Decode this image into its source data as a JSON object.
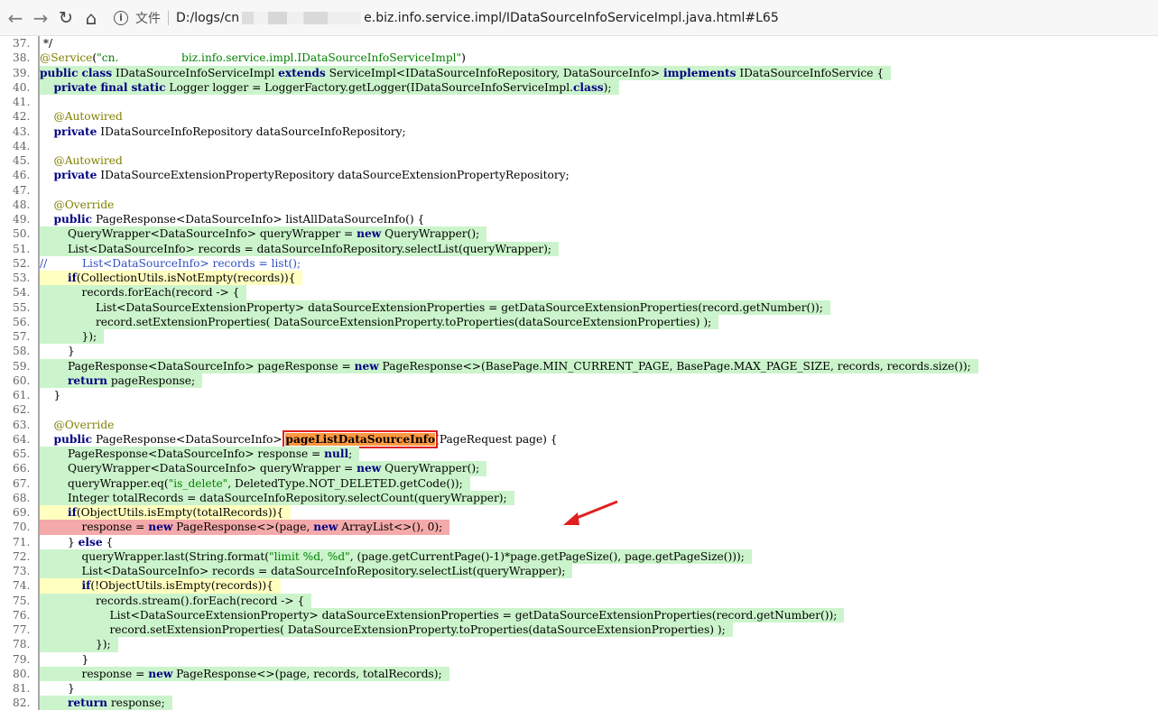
{
  "browser": {
    "back_icon": "back-arrow-icon",
    "forward_icon": "forward-arrow-icon",
    "reload_icon": "reload-icon",
    "home_icon": "home-icon",
    "file_label": "文件",
    "url_prefix": "D:/logs/cn",
    "url_rest": "e.biz.info.service.impl/IDataSourceInfoServiceImpl.java.html#L65"
  },
  "code_lines": [
    {
      "num": "37.",
      "text": " */",
      "hl": ""
    },
    {
      "num": "38.",
      "text": "@Service(\"cn.                  biz.info.service.impl.IDataSourceInfoServiceImpl\")",
      "hl": ""
    },
    {
      "num": "39.",
      "text": "public class IDataSourceInfoServiceImpl extends ServiceImpl<IDataSourceInfoRepository, DataSourceInfo> implements IDataSourceInfoService {",
      "hl": "green"
    },
    {
      "num": "40.",
      "text": "    private final static Logger logger = LoggerFactory.getLogger(IDataSourceInfoServiceImpl.class);",
      "hl": "green"
    },
    {
      "num": "41.",
      "text": "",
      "hl": ""
    },
    {
      "num": "42.",
      "text": "    @Autowired",
      "hl": ""
    },
    {
      "num": "43.",
      "text": "    private IDataSourceInfoRepository dataSourceInfoRepository;",
      "hl": ""
    },
    {
      "num": "44.",
      "text": "",
      "hl": ""
    },
    {
      "num": "45.",
      "text": "    @Autowired",
      "hl": ""
    },
    {
      "num": "46.",
      "text": "    private IDataSourceExtensionPropertyRepository dataSourceExtensionPropertyRepository;",
      "hl": ""
    },
    {
      "num": "47.",
      "text": "",
      "hl": ""
    },
    {
      "num": "48.",
      "text": "    @Override",
      "hl": ""
    },
    {
      "num": "49.",
      "text": "    public PageResponse<DataSourceInfo> listAllDataSourceInfo() {",
      "hl": ""
    },
    {
      "num": "50.",
      "text": "        QueryWrapper<DataSourceInfo> queryWrapper = new QueryWrapper();",
      "hl": "green"
    },
    {
      "num": "51.",
      "text": "        List<DataSourceInfo> records = dataSourceInfoRepository.selectList(queryWrapper);",
      "hl": "green"
    },
    {
      "num": "52.",
      "text": "//          List<DataSourceInfo> records = list();",
      "hl": "comment"
    },
    {
      "num": "53.",
      "text": "        if(CollectionUtils.isNotEmpty(records)){",
      "hl": "yellow"
    },
    {
      "num": "54.",
      "text": "            records.forEach(record -> {",
      "hl": "green"
    },
    {
      "num": "55.",
      "text": "                List<DataSourceExtensionProperty> dataSourceExtensionProperties = getDataSourceExtensionProperties(record.getNumber());",
      "hl": "green"
    },
    {
      "num": "56.",
      "text": "                record.setExtensionProperties( DataSourceExtensionProperty.toProperties(dataSourceExtensionProperties) );",
      "hl": "green"
    },
    {
      "num": "57.",
      "text": "            });",
      "hl": "green"
    },
    {
      "num": "58.",
      "text": "        }",
      "hl": ""
    },
    {
      "num": "59.",
      "text": "        PageResponse<DataSourceInfo> pageResponse = new PageResponse<>(BasePage.MIN_CURRENT_PAGE, BasePage.MAX_PAGE_SIZE, records, records.size());",
      "hl": "green"
    },
    {
      "num": "60.",
      "text": "        return pageResponse;",
      "hl": "green"
    },
    {
      "num": "61.",
      "text": "    }",
      "hl": ""
    },
    {
      "num": "62.",
      "text": "",
      "hl": ""
    },
    {
      "num": "63.",
      "text": "    @Override",
      "hl": ""
    },
    {
      "num": "64.",
      "text": "    public PageResponse<DataSourceInfo> pageListDataSourceInfo(PageRequest page) {",
      "hl": ""
    },
    {
      "num": "65.",
      "text": "        PageResponse<DataSourceInfo> response = null;",
      "hl": "green"
    },
    {
      "num": "66.",
      "text": "        QueryWrapper<DataSourceInfo> queryWrapper = new QueryWrapper();",
      "hl": "green"
    },
    {
      "num": "67.",
      "text": "        queryWrapper.eq(\"is_delete\", DeletedType.NOT_DELETED.getCode());",
      "hl": "green"
    },
    {
      "num": "68.",
      "text": "        Integer totalRecords = dataSourceInfoRepository.selectCount(queryWrapper);",
      "hl": "green"
    },
    {
      "num": "69.",
      "text": "        if(ObjectUtils.isEmpty(totalRecords)){",
      "hl": "yellow"
    },
    {
      "num": "70.",
      "text": "            response = new PageResponse<>(page, new ArrayList<>(), 0);",
      "hl": "red"
    },
    {
      "num": "71.",
      "text": "        } else {",
      "hl": ""
    },
    {
      "num": "72.",
      "text": "            queryWrapper.last(String.format(\"limit %d, %d\", (page.getCurrentPage()-1)*page.getPageSize(), page.getPageSize()));",
      "hl": "green"
    },
    {
      "num": "73.",
      "text": "            List<DataSourceInfo> records = dataSourceInfoRepository.selectList(queryWrapper);",
      "hl": "green"
    },
    {
      "num": "74.",
      "text": "            if(!ObjectUtils.isEmpty(records)){",
      "hl": "yellow"
    },
    {
      "num": "75.",
      "text": "                records.stream().forEach(record -> {",
      "hl": "green"
    },
    {
      "num": "76.",
      "text": "                    List<DataSourceExtensionProperty> dataSourceExtensionProperties = getDataSourceExtensionProperties(record.getNumber());",
      "hl": "green"
    },
    {
      "num": "77.",
      "text": "                    record.setExtensionProperties( DataSourceExtensionProperty.toProperties(dataSourceExtensionProperties) );",
      "hl": "green"
    },
    {
      "num": "78.",
      "text": "                });",
      "hl": "green"
    },
    {
      "num": "79.",
      "text": "            }",
      "hl": ""
    },
    {
      "num": "80.",
      "text": "            response = new PageResponse<>(page, records, totalRecords);",
      "hl": "green"
    },
    {
      "num": "81.",
      "text": "        }",
      "hl": ""
    },
    {
      "num": "82.",
      "text": "        return response;",
      "hl": "green"
    }
  ],
  "highlight_box_text": "pageListDataSourceInfo",
  "colors": {
    "covered": "#ccf4cc",
    "partial": "#ffffc0",
    "missed": "#f4aaaa",
    "annotation_box": "#e02020"
  }
}
